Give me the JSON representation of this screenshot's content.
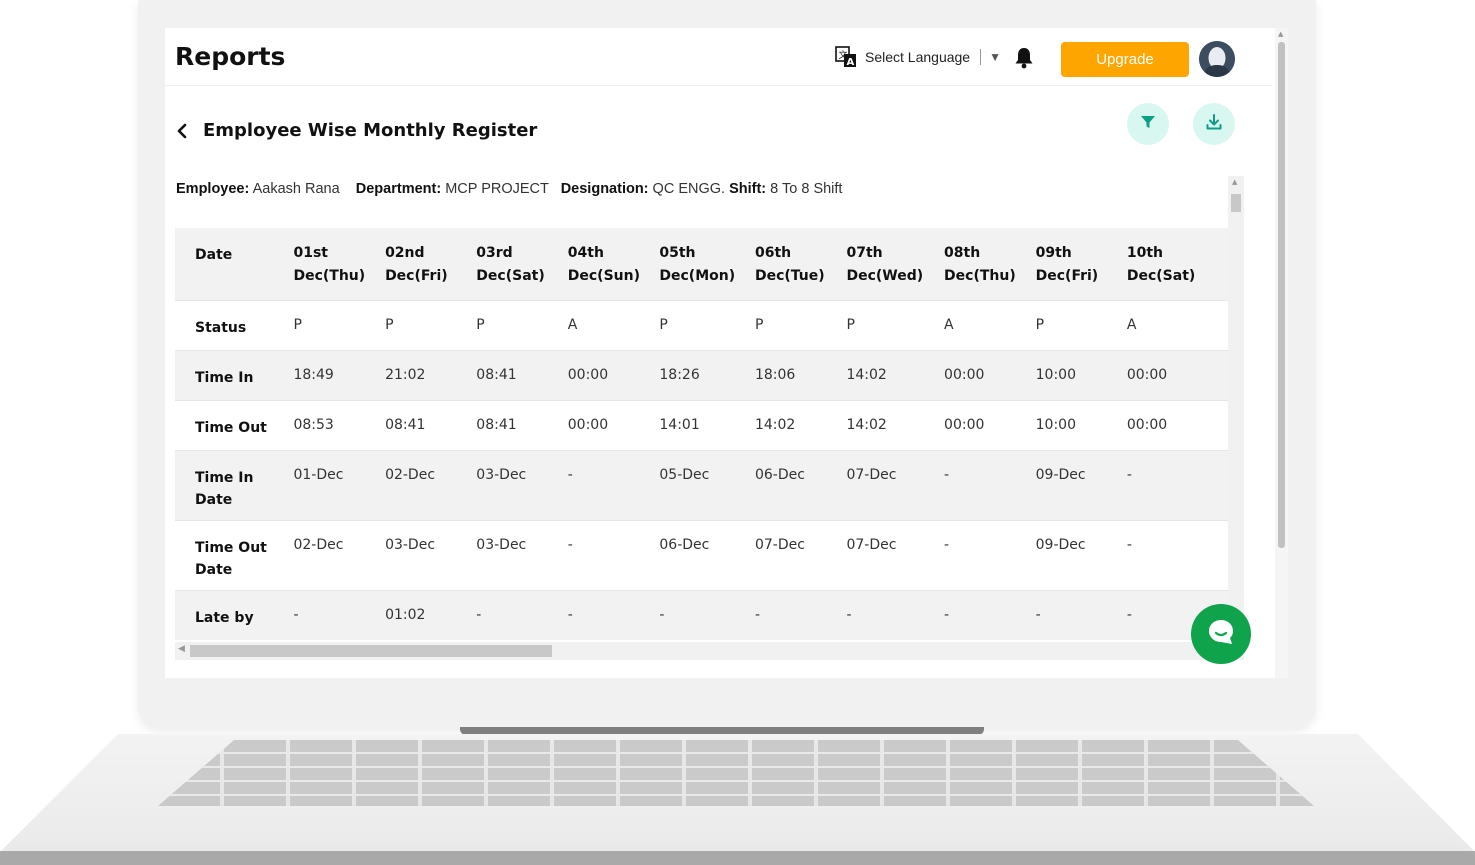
{
  "app": {
    "title": "Reports",
    "language_label": "Select Language",
    "upgrade_label": "Upgrade",
    "accent_color": "#ffa500",
    "chat_color": "#0fa34b"
  },
  "page": {
    "title": "Employee Wise Monthly Register"
  },
  "employee_info": {
    "employee_label": "Employee:",
    "employee_value": "Aakash Rana",
    "department_label": "Department:",
    "department_value": "MCP PROJECT",
    "designation_label": "Designation:",
    "designation_value": "QC ENGG.",
    "shift_label": "Shift:",
    "shift_value": "8 To 8 Shift"
  },
  "register": {
    "header_label": "Date",
    "columns": [
      {
        "day": "01st",
        "date": "Dec(Thu)"
      },
      {
        "day": "02nd",
        "date": "Dec(Fri)"
      },
      {
        "day": "03rd",
        "date": "Dec(Sat)"
      },
      {
        "day": "04th",
        "date": "Dec(Sun)"
      },
      {
        "day": "05th",
        "date": "Dec(Mon)"
      },
      {
        "day": "06th",
        "date": "Dec(Tue)"
      },
      {
        "day": "07th",
        "date": "Dec(Wed)"
      },
      {
        "day": "08th",
        "date": "Dec(Thu)"
      },
      {
        "day": "09th",
        "date": "Dec(Fri)"
      },
      {
        "day": "10th",
        "date": "Dec(Sat)"
      }
    ],
    "rows": [
      {
        "label": "Status",
        "values": [
          "P",
          "P",
          "P",
          "A",
          "P",
          "P",
          "P",
          "A",
          "P",
          "A"
        ]
      },
      {
        "label": "Time In",
        "values": [
          "18:49",
          "21:02",
          "08:41",
          "00:00",
          "18:26",
          "18:06",
          "14:02",
          "00:00",
          "10:00",
          "00:00"
        ]
      },
      {
        "label": "Time Out",
        "values": [
          "08:53",
          "08:41",
          "08:41",
          "00:00",
          "14:01",
          "14:02",
          "14:02",
          "00:00",
          "10:00",
          "00:00"
        ]
      },
      {
        "label": "Time In Date",
        "values": [
          "01-Dec",
          "02-Dec",
          "03-Dec",
          "-",
          "05-Dec",
          "06-Dec",
          "07-Dec",
          "-",
          "09-Dec",
          "-"
        ]
      },
      {
        "label": "Time Out Date",
        "values": [
          "02-Dec",
          "03-Dec",
          "03-Dec",
          "-",
          "06-Dec",
          "07-Dec",
          "07-Dec",
          "-",
          "09-Dec",
          "-"
        ]
      },
      {
        "label": "Late by",
        "values": [
          "-",
          "01:02",
          "-",
          "-",
          "-",
          "-",
          "-",
          "-",
          "-",
          "-"
        ]
      }
    ]
  }
}
